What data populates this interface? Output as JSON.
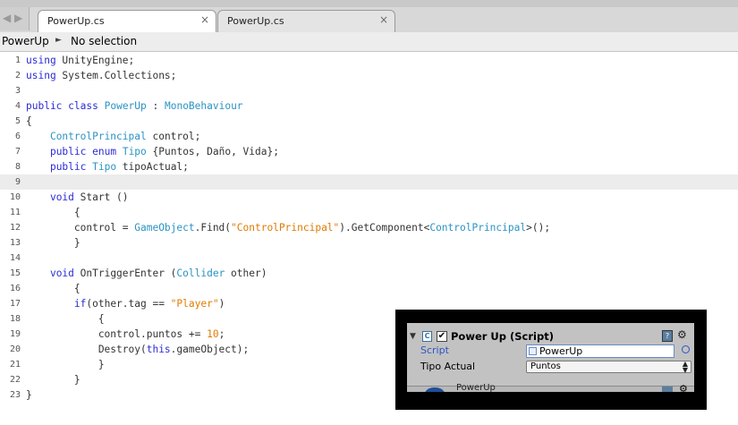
{
  "tabs": [
    {
      "label": "PowerUp.cs",
      "close": "×",
      "active": true
    },
    {
      "label": "PowerUp.cs",
      "close": "×",
      "active": false
    }
  ],
  "breadcrumb": {
    "file": "PowerUp",
    "arrow": "►",
    "selection": "No selection"
  },
  "code_lines": [
    {
      "n": "1",
      "html": "<span class=\"k\">using</span> UnityEngine;"
    },
    {
      "n": "2",
      "html": "<span class=\"k\">using</span> System.Collections;"
    },
    {
      "n": "3",
      "html": ""
    },
    {
      "n": "4",
      "html": "<span class=\"k\">public</span> <span class=\"k\">class</span> <span class=\"t\">PowerUp</span> : <span class=\"t\">MonoBehaviour</span>"
    },
    {
      "n": "5",
      "html": "{"
    },
    {
      "n": "6",
      "html": "    <span class=\"t\">ControlPrincipal</span> control;"
    },
    {
      "n": "7",
      "html": "    <span class=\"k\">public</span> <span class=\"k\">enum</span> <span class=\"t\">Tipo</span> {Puntos, Daño, Vida};"
    },
    {
      "n": "8",
      "html": "    <span class=\"k\">public</span> <span class=\"t\">Tipo</span> tipoActual;"
    },
    {
      "n": "9",
      "html": "",
      "hl": true
    },
    {
      "n": "10",
      "html": "    <span class=\"k\">void</span> Start ()"
    },
    {
      "n": "11",
      "html": "        {"
    },
    {
      "n": "12",
      "html": "        control = <span class=\"t\">GameObject</span>.Find(<span class=\"s\">\"ControlPrincipal\"</span>).GetComponent&lt;<span class=\"t\">ControlPrincipal</span>&gt;();"
    },
    {
      "n": "13",
      "html": "        }"
    },
    {
      "n": "14",
      "html": ""
    },
    {
      "n": "15",
      "html": "    <span class=\"k\">void</span> OnTriggerEnter (<span class=\"t\">Collider</span> other)"
    },
    {
      "n": "16",
      "html": "        {"
    },
    {
      "n": "17",
      "html": "        <span class=\"k\">if</span>(other.tag == <span class=\"s\">\"Player\"</span>)"
    },
    {
      "n": "18",
      "html": "            {"
    },
    {
      "n": "19",
      "html": "            control.puntos += <span class=\"n\">10</span>;"
    },
    {
      "n": "20",
      "html": "            Destroy(<span class=\"k\">this</span>.gameObject);"
    },
    {
      "n": "21",
      "html": "            }"
    },
    {
      "n": "22",
      "html": "        }"
    },
    {
      "n": "23",
      "html": "}"
    }
  ],
  "inspector": {
    "collapse_icon": "▼",
    "checkbox": "✔",
    "title": "Power Up (Script)",
    "script_label": "Script",
    "script_value": "PowerUp",
    "tipo_label": "Tipo Actual",
    "tipo_value": "Puntos",
    "next_component": "PowerUp"
  },
  "colors": {
    "keyword": "#2b2bd6",
    "type": "#2b93c3",
    "string": "#e07b00",
    "inspector_bg": "#c2c2c2"
  }
}
